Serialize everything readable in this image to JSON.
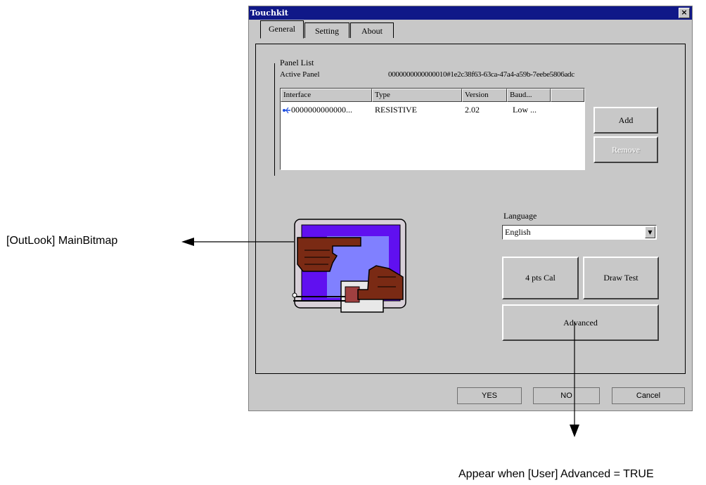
{
  "window": {
    "title": "Touchkit",
    "close_glyph": "×"
  },
  "tabs": [
    {
      "label": "General",
      "active": true
    },
    {
      "label": "Setting",
      "active": false
    },
    {
      "label": "About",
      "active": false
    }
  ],
  "panel_list": {
    "group_label": "Panel List",
    "active_panel_label": "Active Panel",
    "active_panel_value": "0000000000000010#1e2c38f63-63ca-47a4-a59b-7eebe5806adc"
  },
  "list": {
    "columns": [
      "Interface",
      "Type",
      "Version",
      "Baud..."
    ],
    "rows": [
      {
        "icon": "usb-icon",
        "interface": "0000000000000...",
        "type": "RESISTIVE",
        "version": "2.02",
        "baud": "Low ..."
      }
    ]
  },
  "buttons": {
    "add": "Add",
    "remove": "Remove",
    "cal": "4 pts Cal",
    "draw_test": "Draw Test",
    "advanced": "Advanced",
    "yes": "YES",
    "no": "NO",
    "cancel": "Cancel"
  },
  "language": {
    "label": "Language",
    "selected": "English"
  },
  "annotations": {
    "bitmap_label": "[OutLook] MainBitmap",
    "advanced_note": "Appear when [User] Advanced = TRUE"
  },
  "colors": {
    "titlebar": "#101888",
    "dialog_face": "#c8c8c8",
    "usb_icon": "#2050e0"
  }
}
